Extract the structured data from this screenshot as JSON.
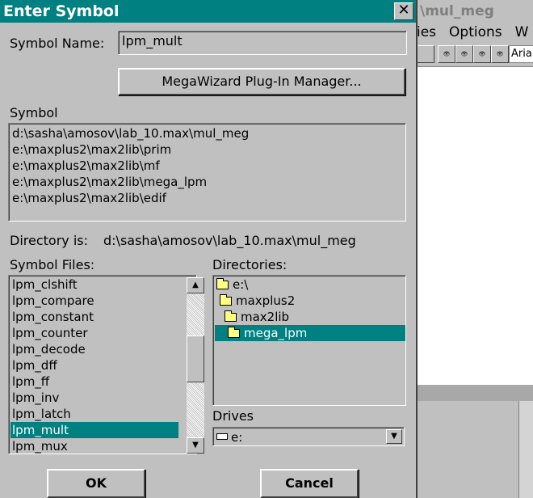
{
  "background_window": {
    "title": "\\mul_meg",
    "menu": [
      "ies",
      "Options",
      "W"
    ],
    "font_box": "Aria"
  },
  "dialog": {
    "title": "Enter Symbol",
    "close_glyph": "✕",
    "symbol_name_label": "Symbol Name:",
    "symbol_name_value": "lpm_mult",
    "megawizard_button": "MegaWizard Plug-In Manager...",
    "symbol_label": "Symbol",
    "symbol_paths": [
      "d:\\sasha\\amosov\\lab_10.max\\mul_meg",
      "e:\\maxplus2\\max2lib\\prim",
      "e:\\maxplus2\\max2lib\\mf",
      "e:\\maxplus2\\max2lib\\mega_lpm",
      "e:\\maxplus2\\max2lib\\edif"
    ],
    "directory_is_label": "Directory is:",
    "directory_is_value": "d:\\sasha\\amosov\\lab_10.max\\mul_meg",
    "symbol_files_label": "Symbol Files:",
    "symbol_files": [
      "lpm_clshift",
      "lpm_compare",
      "lpm_constant",
      "lpm_counter",
      "lpm_decode",
      "lpm_dff",
      "lpm_ff",
      "lpm_inv",
      "lpm_latch",
      "lpm_mult",
      "lpm_mux"
    ],
    "selected_file": "lpm_mult",
    "directories_label": "Directories:",
    "directories": [
      "e:\\",
      "maxplus2",
      "max2lib",
      "mega_lpm"
    ],
    "selected_directory": "mega_lpm",
    "drives_label": "Drives",
    "drive_value": "e:",
    "ok_button": "OK",
    "cancel_button": "Cancel"
  },
  "colors": {
    "title_bar": "#008080",
    "selection": "#008080",
    "face": "#c0c0c0"
  }
}
